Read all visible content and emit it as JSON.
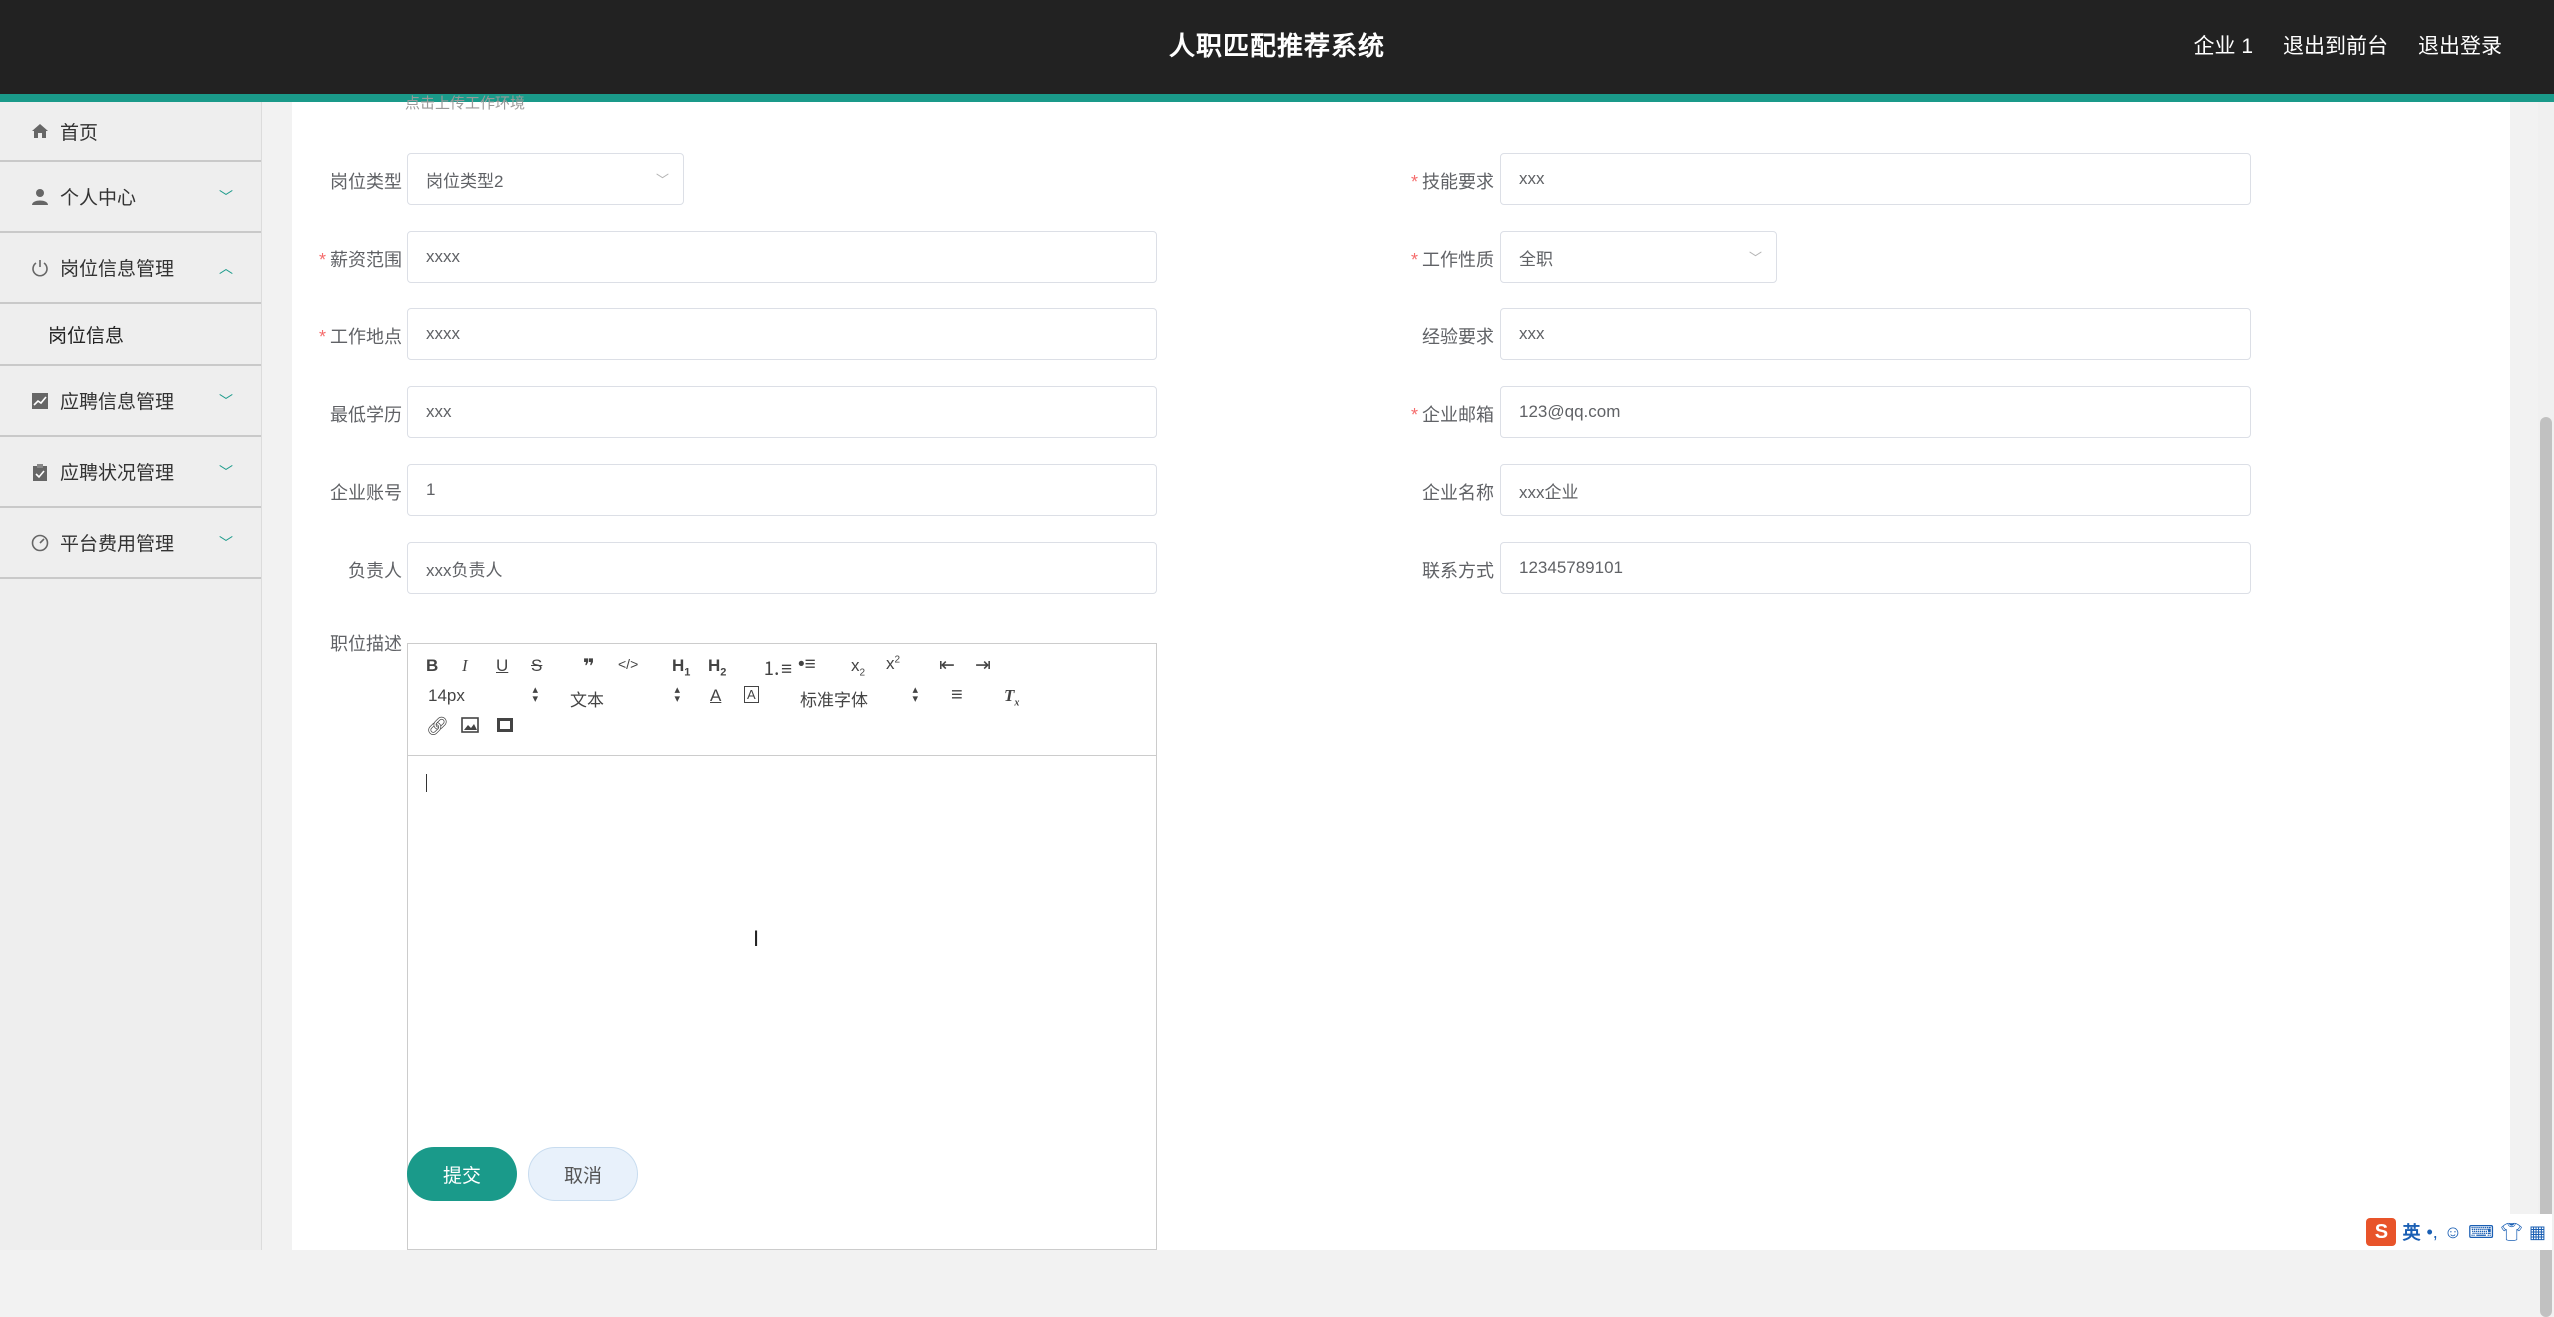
{
  "header": {
    "title": "人职匹配推荐系统",
    "links": [
      "企业 1",
      "退出到前台",
      "退出登录"
    ]
  },
  "sidebar": {
    "items": [
      {
        "label": "首页",
        "icon": "home-icon"
      },
      {
        "label": "个人中心",
        "icon": "user-icon"
      },
      {
        "label": "岗位信息管理",
        "icon": "power-icon"
      },
      {
        "label": "岗位信息"
      },
      {
        "label": "应聘信息管理",
        "icon": "chart-icon"
      },
      {
        "label": "应聘状况管理",
        "icon": "clipboard-icon"
      },
      {
        "label": "平台费用管理",
        "icon": "gauge-icon"
      }
    ]
  },
  "form": {
    "upload_tip": "点击上传工作环境",
    "labels": {
      "job_type": "岗位类型",
      "skills": "技能要求",
      "salary": "薪资范围",
      "nature": "工作性质",
      "location": "工作地点",
      "experience": "经验要求",
      "education": "最低学历",
      "email": "企业邮箱",
      "account": "企业账号",
      "company": "企业名称",
      "manager": "负责人",
      "contact": "联系方式",
      "description": "职位描述"
    },
    "values": {
      "job_type": "岗位类型2",
      "skills": "xxx",
      "salary": "xxxx",
      "nature": "全职",
      "location": "xxxx",
      "experience": "xxx",
      "education": "xxx",
      "email": "123@qq.com",
      "account": "1",
      "company": "xxx企业",
      "manager": "xxx负责人",
      "contact": "12345789101"
    }
  },
  "editor": {
    "font_size": "14px",
    "header_select": "文本",
    "font_family": "标准字体"
  },
  "buttons": {
    "submit": "提交",
    "cancel": "取消"
  },
  "ime": {
    "mode": "英"
  },
  "colors": {
    "accent": "#1a9a8a",
    "topbar": "#222222",
    "required": "#f56c6c"
  }
}
